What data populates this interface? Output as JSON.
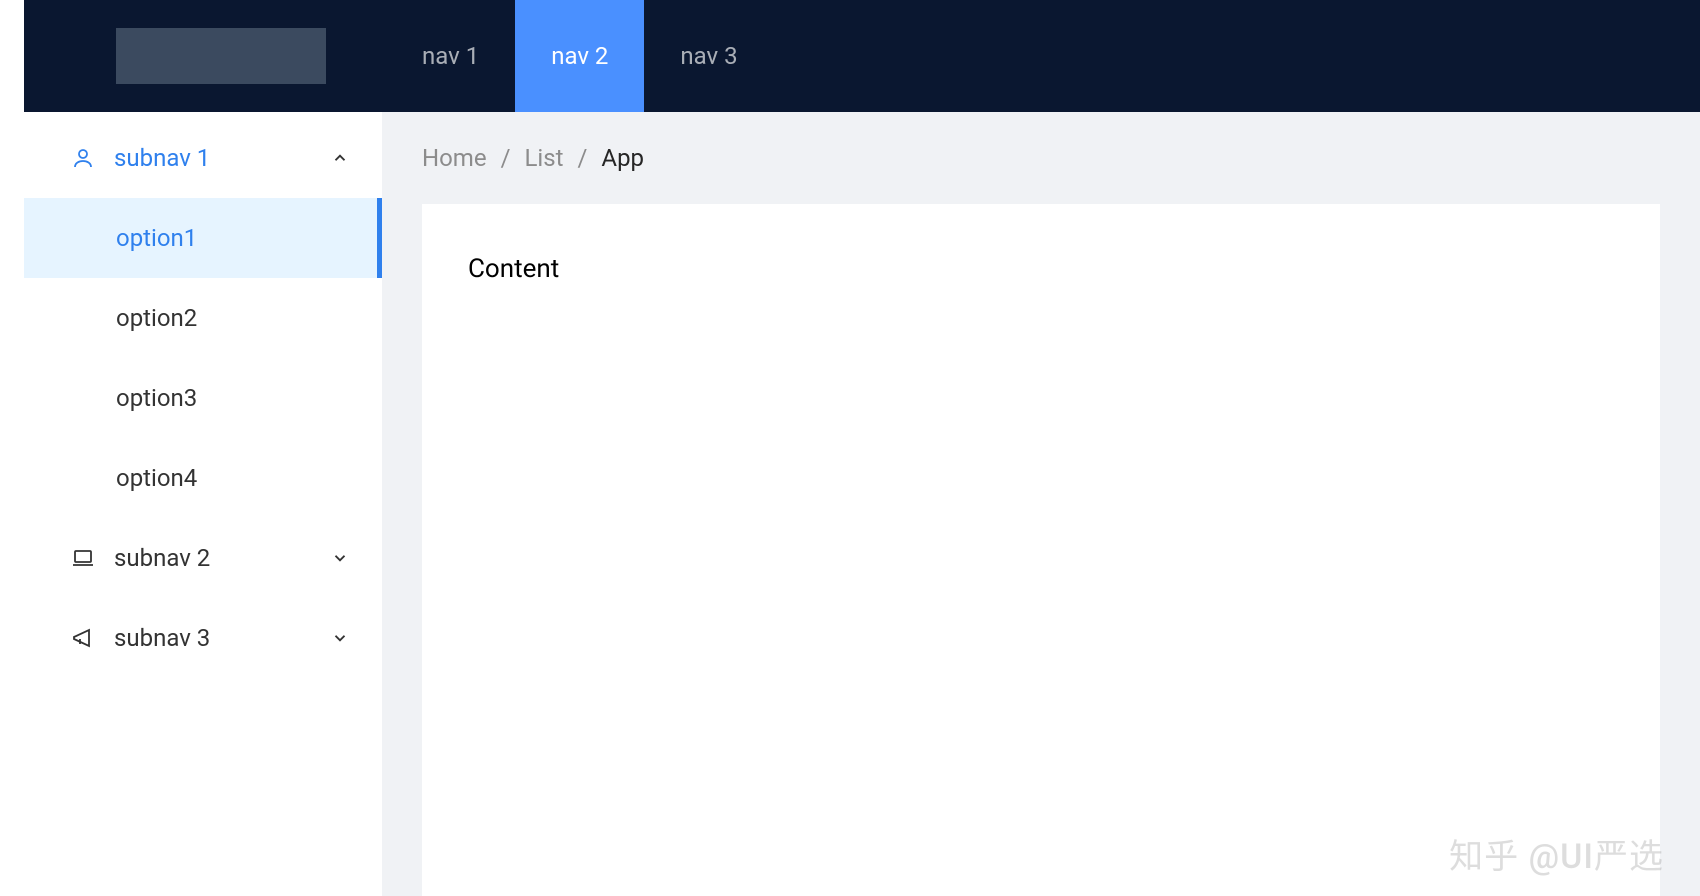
{
  "header": {
    "nav": [
      {
        "label": "nav 1",
        "active": false
      },
      {
        "label": "nav 2",
        "active": true
      },
      {
        "label": "nav 3",
        "active": false
      }
    ]
  },
  "sidebar": {
    "subnavs": [
      {
        "label": "subnav 1",
        "icon": "user",
        "open": true,
        "options": [
          {
            "label": "option1",
            "selected": true
          },
          {
            "label": "option2",
            "selected": false
          },
          {
            "label": "option3",
            "selected": false
          },
          {
            "label": "option4",
            "selected": false
          }
        ]
      },
      {
        "label": "subnav 2",
        "icon": "laptop",
        "open": false,
        "options": []
      },
      {
        "label": "subnav 3",
        "icon": "notification",
        "open": false,
        "options": []
      }
    ]
  },
  "breadcrumb": {
    "items": [
      {
        "label": "Home",
        "current": false
      },
      {
        "label": "List",
        "current": false
      },
      {
        "label": "App",
        "current": true
      }
    ],
    "separator": "/"
  },
  "content": {
    "body": "Content"
  },
  "watermark": "知乎 @UI严选"
}
